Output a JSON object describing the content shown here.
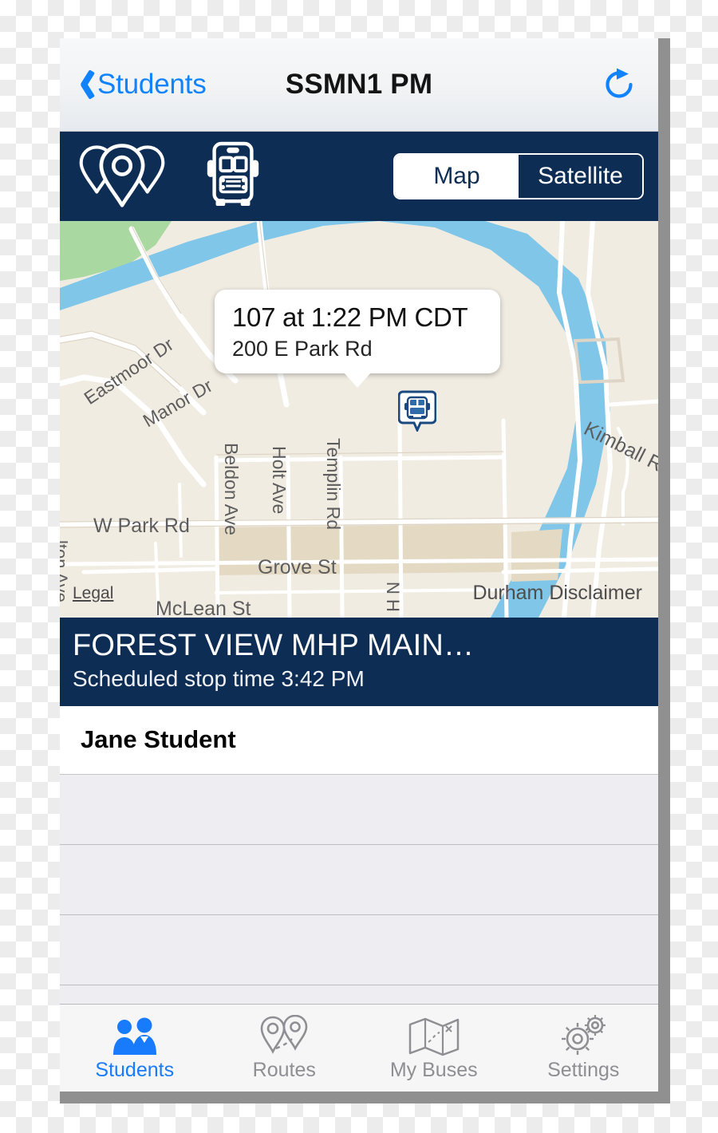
{
  "navbar": {
    "back_label": "Students",
    "title": "SSMN1 PM",
    "refresh_icon": "refresh-icon",
    "back_icon": "chevron-left-icon"
  },
  "map_toolbar": {
    "pins_icon": "map-pins-icon",
    "bus_icon": "school-bus-icon",
    "segments": [
      {
        "label": "Map",
        "active": true
      },
      {
        "label": "Satellite",
        "active": false
      }
    ]
  },
  "map": {
    "callout": {
      "title": "107 at 1:22 PM CDT",
      "subtitle": "200 E Park Rd"
    },
    "bus_marker_icon": "bus-marker-icon",
    "legal_label": "Legal",
    "disclaimer_label": "Durham Disclaimer",
    "street_labels": [
      "Eastmoor Dr",
      "Manor Dr",
      "Beldon Ave",
      "Holt Ave",
      "Templin Rd",
      "Kimball Rd",
      "W Park Rd",
      "Grove St",
      "McLean St",
      "lton Ave",
      "N H"
    ],
    "colors": {
      "land": "#f1ece2",
      "water": "#7fc6e8",
      "park": "#a9d8a0",
      "building": "#e4d9c3",
      "road": "#ffffff"
    }
  },
  "stop_banner": {
    "stop_name": "FOREST VIEW MHP MAIN…",
    "scheduled_time": "Scheduled stop time 3:42 PM"
  },
  "student_list": {
    "rows": [
      {
        "name": "Jane Student",
        "filled": true
      },
      {
        "name": "",
        "filled": false
      },
      {
        "name": "",
        "filled": false
      },
      {
        "name": "",
        "filled": false
      },
      {
        "name": "",
        "filled": false
      }
    ]
  },
  "tabbar": {
    "tabs": [
      {
        "label": "Students",
        "icon": "students-icon",
        "active": true
      },
      {
        "label": "Routes",
        "icon": "routes-pins-icon",
        "active": false
      },
      {
        "label": "My Buses",
        "icon": "folded-map-icon",
        "active": false
      },
      {
        "label": "Settings",
        "icon": "gears-icon",
        "active": false
      }
    ]
  },
  "theme": {
    "navy": "#0d2d55",
    "accent_blue": "#1283ff",
    "tab_inactive": "#8e8e93",
    "frame_shadow": "#909090"
  }
}
